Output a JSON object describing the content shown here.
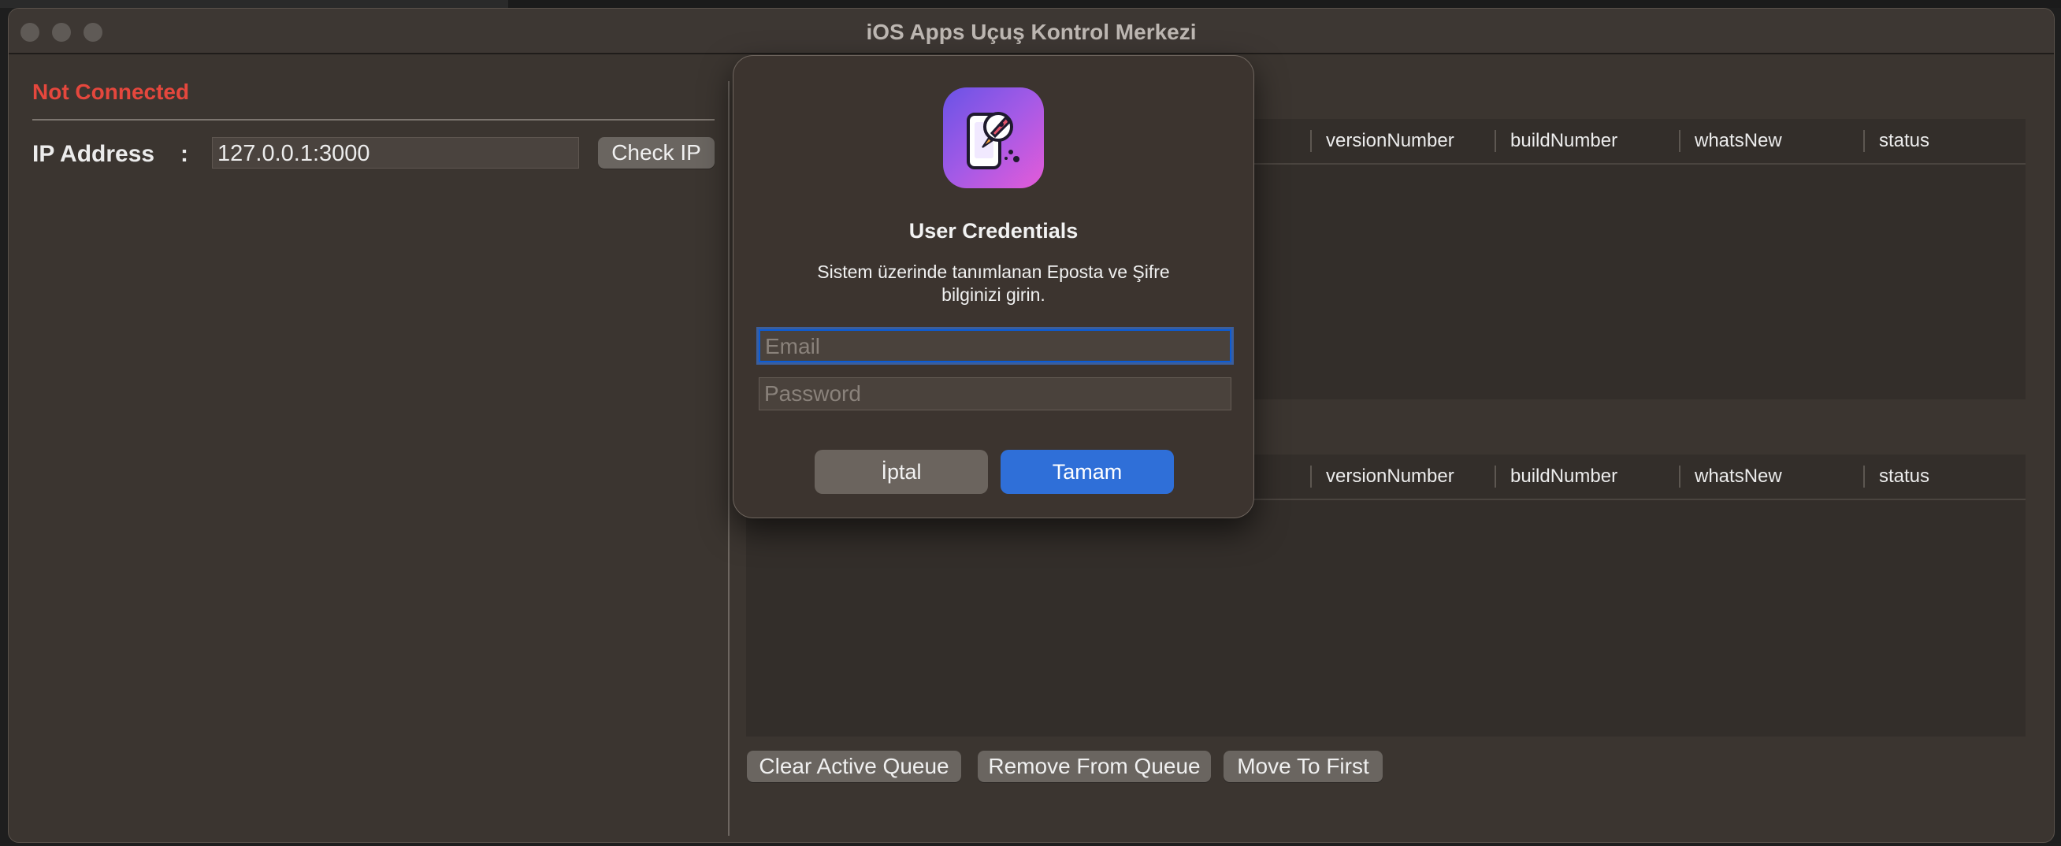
{
  "window": {
    "title": "iOS Apps Uçuş Kontrol Merkezi"
  },
  "left_panel": {
    "status": "Not Connected",
    "ip_label": "IP Address",
    "ip_colon": ":",
    "ip_value": "127.0.0.1:3000",
    "check_ip_label": "Check IP"
  },
  "table_top": {
    "columns": [
      "versionNumber",
      "buildNumber",
      "whatsNew",
      "status"
    ]
  },
  "table_bottom": {
    "columns": [
      "versionNumber",
      "buildNumber",
      "whatsNew",
      "status"
    ]
  },
  "queue_actions": {
    "clear_label": "Clear Active Queue",
    "remove_label": "Remove From Queue",
    "move_first_label": "Move To First"
  },
  "dialog": {
    "title": "User Credentials",
    "message_line1": "Sistem üzerinde tanımlanan Eposta ve Şifre",
    "message_line2": "bilginizi girin.",
    "email_placeholder": "Email",
    "password_placeholder": "Password",
    "cancel_label": "İptal",
    "ok_label": "Tamam"
  },
  "colors": {
    "not_connected": "#e5473d",
    "ok_button": "#2f6fd8",
    "focus_ring": "#3a82f6"
  },
  "icons": [
    "close-dot",
    "minimize-dot",
    "zoom-dot",
    "rocket-phone-app-icon"
  ]
}
